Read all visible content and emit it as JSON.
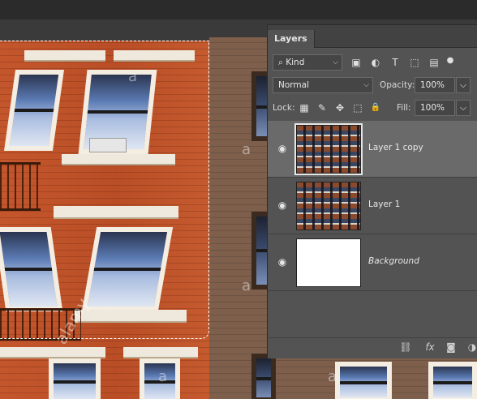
{
  "panel": {
    "tab_label": "Layers",
    "filter": {
      "value": "Kind"
    },
    "blend_mode": {
      "value": "Normal"
    },
    "opacity": {
      "label": "Opacity:",
      "value": "100%"
    },
    "lock": {
      "label": "Lock:"
    },
    "fill": {
      "label": "Fill:",
      "value": "100%"
    },
    "layers": [
      {
        "name": "Layer 1 copy",
        "visible": true,
        "selected": true,
        "thumb": "image"
      },
      {
        "name": "Layer 1",
        "visible": true,
        "selected": false,
        "thumb": "image"
      },
      {
        "name": "Background",
        "visible": true,
        "selected": false,
        "thumb": "white",
        "italic": true
      }
    ],
    "bottom_icons": [
      "link-icon",
      "fx-icon",
      "mask-icon",
      "adjustment-icon"
    ],
    "bottom_fx_label": "fx"
  },
  "watermarks": [
    "a",
    "a",
    "a",
    "a",
    "a",
    "alamy"
  ],
  "icons": {
    "search": "⌕",
    "eye": "◉",
    "image_filter": "▣",
    "adjust_filter": "◐",
    "type_filter": "T",
    "shape_filter": "⬚",
    "smart_filter": "▤",
    "lock_pixels": "▦",
    "lock_brush": "✎",
    "lock_move": "✥",
    "lock_artboard": "⬚",
    "lock_all": "🔒",
    "link": "⛓",
    "mask": "◙",
    "adjustment": "◑"
  }
}
